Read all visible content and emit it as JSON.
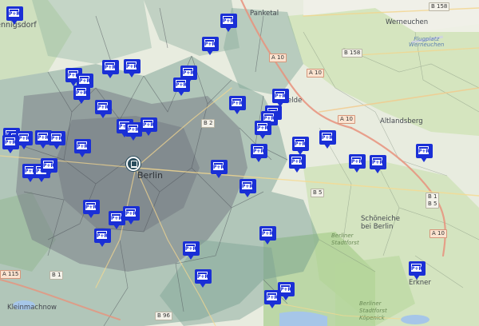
{
  "map": {
    "marker_label": "P+R",
    "marker_icon": "park-and-ride-icon",
    "station_icon": "train-station-icon",
    "marker_color": "#1a2fd6",
    "place_labels": {
      "hennigsdorf": "Hennigsdorf",
      "panketal": "Panketal",
      "werneuchen": "Werneuchen",
      "ahrensfelde": "elde",
      "altlandsberg": "Altlandsberg",
      "berlin": "Berlin",
      "schoeneiche": "Schöneiche\nbei Berlin",
      "berliner_stadtforst": "Berliner\nStadtforst",
      "erkner": "Erkner",
      "kleinmachnow": "Kleinmachnow",
      "berliner_stadtforst_koepenick": "Berliner\nStadtforst\nKöpenick"
    },
    "water_labels": {
      "flugplatz": "Flugplatz\nWerneuchen"
    },
    "road_labels": {
      "b158_top": "B 158",
      "b158_mid": "B 158",
      "a10_north": "A 10",
      "a10_mid": "A 10",
      "a10_east": "A 10",
      "a10_ne": "A 10",
      "a10_se": "A 10",
      "b2": "B 2",
      "b5": "B 5",
      "b1_b5": "B 1\nB 5",
      "a115": "A 115",
      "b1": "B 1",
      "b96": "B 96"
    }
  }
}
